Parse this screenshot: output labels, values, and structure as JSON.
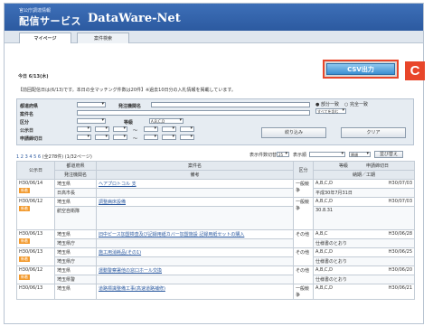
{
  "header": {
    "subtitle": "官公庁調達情報",
    "title": "配信サービス",
    "brand": "DataWare-Net"
  },
  "tabs": [
    {
      "label": "マイページ",
      "active": true
    },
    {
      "label": "案件検索",
      "active": false
    }
  ],
  "page": {
    "date": "今日 6/13(木)",
    "notice": "【前回配信日は(6/13)です。本日の全マッチング件数は20件】※過去10日分の入札情報を掲載しています。"
  },
  "csv_button": {
    "label": "CSV出力",
    "badge": "C",
    "accent": "#e8462a"
  },
  "search": {
    "labels": {
      "prefecture": "都道府県",
      "issuer": "発注機関名",
      "case_name": "案件名",
      "category": "区分",
      "grade": "等級",
      "announce_date": "公示日",
      "deadline": "申請締切日"
    },
    "grade_value": "A,B,C,D",
    "radio_partial": "部分一致",
    "radio_exact": "完全一致",
    "all_label": "すべてを含む",
    "filter_button": "絞り込み",
    "clear_button": "クリア",
    "range_sep": "〜"
  },
  "pager": {
    "pages": [
      "1",
      "2",
      "3",
      "4",
      "5",
      "6"
    ],
    "total": "(全278件)",
    "range": "(1/32ページ)",
    "display_switch": "表示件数切替",
    "per_page": "25",
    "order_label": "表示順",
    "order_value": "降順",
    "sort_button": "並び替え"
  },
  "table": {
    "headers": {
      "announce_date": "公示日",
      "prefecture": "都道府県",
      "issuer": "発注機関名",
      "case_name": "案件名",
      "note": "備考",
      "category": "区分",
      "grade": "等級",
      "delivery": "納期／工期",
      "deadline": "申請締切日"
    },
    "tag_label": "新着",
    "rows": [
      {
        "date": "H30/06/14",
        "pref": "埼玉県",
        "issuer": "日高市長",
        "name": "ヘアプロトコル 支",
        "category": "一般競争",
        "grade": "A,B,C,D",
        "delivery": "平成30年7月31日",
        "deadline": "H30/07/03"
      },
      {
        "date": "H30/06/12",
        "pref": "埼玉県",
        "issuer": "航空自衛隊",
        "name": "調整病床設備",
        "category": "一般競争",
        "grade": "A,B,C,D",
        "delivery": "30.8.31",
        "deadline": "H30/07/03"
      },
      {
        "date": "H30/06/13",
        "pref": "埼玉県",
        "issuer": "埼玉県庁",
        "name": "旧中ピース加盟検査及び記録用紙カバー加盟施設 記録用紙セットの購入",
        "category": "その他",
        "grade": "A,B,C",
        "delivery": "仕様書のとおり",
        "deadline": "H30/06/28"
      },
      {
        "date": "H30/06/13",
        "pref": "埼玉県",
        "issuer": "埼玉県庁",
        "name": "施工用消耗品(その1)",
        "category": "その他",
        "grade": "A,B,C,D",
        "delivery": "仕様書のとおり",
        "deadline": "H30/06/25"
      },
      {
        "date": "H30/06/12",
        "pref": "埼玉県",
        "issuer": "埼玉県警",
        "name": "運動警察署他の窓口ホール交換",
        "category": "その他",
        "grade": "A,B,C,D",
        "delivery": "仕様書のとおり",
        "deadline": "H30/06/20"
      },
      {
        "date": "H30/06/13",
        "pref": "埼玉県",
        "issuer": "埼玉県庁",
        "name": "道路標識整備工事(高速道路補修)",
        "category": "一般競争",
        "grade": "A,B,C,D",
        "delivery": "",
        "deadline": "H30/06/21"
      }
    ]
  }
}
